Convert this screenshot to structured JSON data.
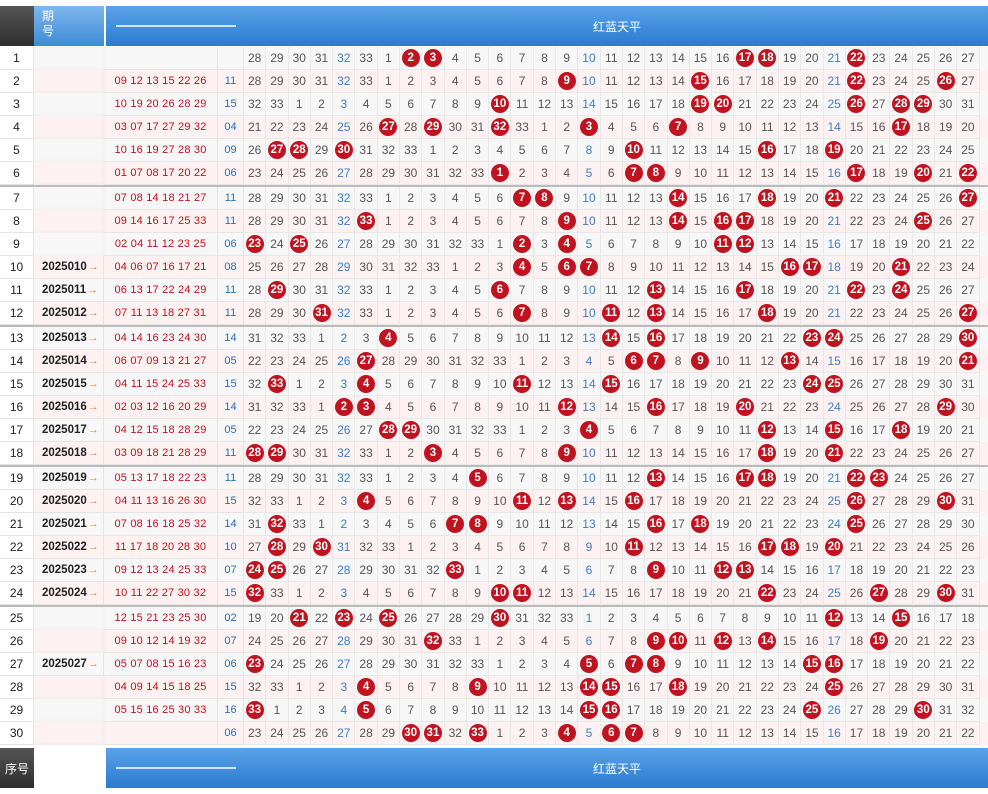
{
  "header": {
    "seq_label": "序号",
    "period_label": "期数号",
    "period_label_top": "期",
    "period_label_bottom": "号",
    "title": "红蓝天平"
  },
  "colors": {
    "ball_red": "#c1121f",
    "header_blue": "#2c7bd1",
    "header_dark": "#2e2e2e",
    "blue_number": "#1f6fbf",
    "red_number": "#c0121b"
  },
  "rows": [
    {
      "idx": "1",
      "period": "",
      "win": "",
      "blue": "",
      "start": "28",
      "hits": [
        "2",
        "3",
        "17",
        "18",
        "22"
      ],
      "blurred": true
    },
    {
      "idx": "2",
      "period": "",
      "win": "09 12 13 15 22 26",
      "blue": "11",
      "start": "28",
      "hits": [
        "9",
        "15",
        "22",
        "26"
      ],
      "blurred": true
    },
    {
      "idx": "3",
      "period": "",
      "win": "10 19 20 26 28 29",
      "blue": "15",
      "start": "32",
      "hits": [
        "10",
        "19",
        "20",
        "26",
        "28",
        "29"
      ],
      "blurred": true
    },
    {
      "idx": "4",
      "period": "",
      "win": "03 07 17 27 29 32",
      "blue": "04",
      "start": "21",
      "hits": [
        "27",
        "29",
        "32",
        "3",
        "7",
        "17"
      ],
      "blurred": true
    },
    {
      "idx": "5",
      "period": "",
      "win": "10 16 19 27 28 30",
      "blue": "09",
      "start": "26",
      "hits": [
        "27",
        "28",
        "30",
        "10",
        "16",
        "19"
      ],
      "blurred": true
    },
    {
      "idx": "6",
      "period": "",
      "win": "01 07 08 17 20 22",
      "blue": "06",
      "start": "23",
      "hits": [
        "1",
        "7",
        "8",
        "17",
        "20",
        "22"
      ],
      "blurred": true
    },
    {
      "idx": "7",
      "period": "",
      "win": "07 08 14 18 21 27",
      "blue": "11",
      "start": "28",
      "hits": [
        "7",
        "8",
        "14",
        "18",
        "21",
        "27"
      ],
      "blurred": true
    },
    {
      "idx": "8",
      "period": "",
      "win": "09 14 16 17 25 33",
      "blue": "11",
      "start": "28",
      "hits": [
        "33",
        "9",
        "14",
        "16",
        "17",
        "25"
      ],
      "blurred": true
    },
    {
      "idx": "9",
      "period": "",
      "win": "02 04 11 12 23 25",
      "blue": "06",
      "start": "23",
      "hits": [
        "23",
        "25",
        "2",
        "4",
        "11",
        "12"
      ],
      "blurred": true
    },
    {
      "idx": "10",
      "period": "2025010",
      "win": "04 06 07 16 17 21",
      "blue": "08",
      "start": "25",
      "hits": [
        "4",
        "6",
        "7",
        "16",
        "17",
        "21"
      ],
      "blurred": false
    },
    {
      "idx": "11",
      "period": "2025011",
      "win": "06 13 17 22 24 29",
      "blue": "11",
      "start": "28",
      "hits": [
        "29",
        "6",
        "13",
        "17",
        "22",
        "24"
      ],
      "blurred": false
    },
    {
      "idx": "12",
      "period": "2025012",
      "win": "07 11 13 18 27 31",
      "blue": "11",
      "start": "28",
      "hits": [
        "31",
        "7",
        "11",
        "13",
        "18",
        "27"
      ],
      "blurred": false
    },
    {
      "idx": "13",
      "period": "2025013",
      "win": "04 14 16 23 24 30",
      "blue": "14",
      "start": "31",
      "hits": [
        "4",
        "14",
        "16",
        "23",
        "24",
        "30"
      ],
      "blurred": false
    },
    {
      "idx": "14",
      "period": "2025014",
      "win": "06 07 09 13 21 27",
      "blue": "05",
      "start": "22",
      "hits": [
        "27",
        "6",
        "7",
        "9",
        "13",
        "21"
      ],
      "blurred": false
    },
    {
      "idx": "15",
      "period": "2025015",
      "win": "04 11 15 24 25 33",
      "blue": "15",
      "start": "32",
      "hits": [
        "33",
        "4",
        "11",
        "15",
        "24",
        "25"
      ],
      "blurred": false
    },
    {
      "idx": "16",
      "period": "2025016",
      "win": "02 03 12 16 20 29",
      "blue": "14",
      "start": "31",
      "hits": [
        "2",
        "3",
        "12",
        "16",
        "20",
        "29"
      ],
      "blurred": false
    },
    {
      "idx": "17",
      "period": "2025017",
      "win": "04 12 15 18 28 29",
      "blue": "05",
      "start": "22",
      "hits": [
        "28",
        "29",
        "4",
        "12",
        "15",
        "18"
      ],
      "blurred": false
    },
    {
      "idx": "18",
      "period": "2025018",
      "win": "03 09 18 21 28 29",
      "blue": "11",
      "start": "28",
      "hits": [
        "28",
        "29",
        "3",
        "9",
        "18",
        "21"
      ],
      "blurred": false
    },
    {
      "idx": "19",
      "period": "2025019",
      "win": "05 13 17 18 22 23",
      "blue": "11",
      "start": "28",
      "hits": [
        "5",
        "13",
        "17",
        "18",
        "22",
        "23"
      ],
      "blurred": false
    },
    {
      "idx": "20",
      "period": "2025020",
      "win": "04 11 13 16 26 30",
      "blue": "15",
      "start": "32",
      "hits": [
        "4",
        "11",
        "13",
        "16",
        "26",
        "30"
      ],
      "blurred": false
    },
    {
      "idx": "21",
      "period": "2025021",
      "win": "07 08 16 18 25 32",
      "blue": "14",
      "start": "31",
      "hits": [
        "32",
        "7",
        "8",
        "16",
        "18",
        "25"
      ],
      "blurred": false
    },
    {
      "idx": "22",
      "period": "2025022",
      "win": "11 17 18 20 28 30",
      "blue": "10",
      "start": "27",
      "hits": [
        "28",
        "30",
        "11",
        "17",
        "18",
        "20"
      ],
      "blurred": false
    },
    {
      "idx": "23",
      "period": "2025023",
      "win": "09 12 13 24 25 33",
      "blue": "07",
      "start": "24",
      "hits": [
        "24",
        "25",
        "33",
        "9",
        "12",
        "13"
      ],
      "blurred": false
    },
    {
      "idx": "24",
      "period": "2025024",
      "win": "10 11 22 27 30 32",
      "blue": "15",
      "start": "32",
      "hits": [
        "32",
        "10",
        "11",
        "22",
        "27",
        "30"
      ],
      "blurred": false
    },
    {
      "idx": "25",
      "period": "",
      "win": "12 15 21 23 25 30",
      "blue": "02",
      "start": "19",
      "hits": [
        "21",
        "23",
        "25",
        "30",
        "12",
        "15"
      ],
      "blurred": true
    },
    {
      "idx": "26",
      "period": "",
      "win": "09 10 12 14 19 32",
      "blue": "07",
      "start": "24",
      "hits": [
        "32",
        "9",
        "10",
        "12",
        "14",
        "19"
      ],
      "blurred": true
    },
    {
      "idx": "27",
      "period": "2025027",
      "win": "05 07 08 15 16 23",
      "blue": "06",
      "start": "23",
      "hits": [
        "23",
        "5",
        "7",
        "8",
        "15",
        "16"
      ],
      "blurred": false
    },
    {
      "idx": "28",
      "period": "",
      "win": "04 09 14 15 18 25",
      "blue": "15",
      "start": "32",
      "hits": [
        "4",
        "9",
        "14",
        "15",
        "18",
        "25"
      ],
      "blurred": true
    },
    {
      "idx": "29",
      "period": "",
      "win": "05 15 16 25 30 33",
      "blue": "16",
      "start": "33",
      "hits": [
        "33",
        "5",
        "15",
        "16",
        "25",
        "30"
      ],
      "blurred": true
    },
    {
      "idx": "30",
      "period": "",
      "win": "",
      "blue": "06",
      "start": "23",
      "hits": [
        "30",
        "31",
        "33",
        "4",
        "6",
        "7"
      ],
      "blurred": true
    }
  ]
}
